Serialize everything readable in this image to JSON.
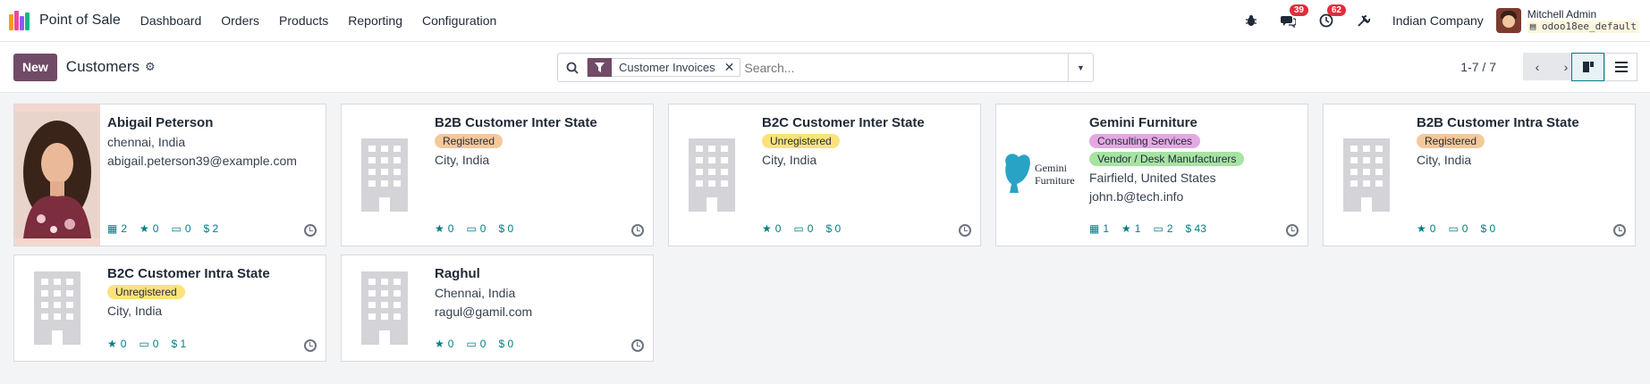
{
  "navbar": {
    "app_name": "Point of Sale",
    "menu": [
      "Dashboard",
      "Orders",
      "Products",
      "Reporting",
      "Configuration"
    ],
    "chat_count": "39",
    "activity_count": "62",
    "company": "Indian Company",
    "user_name": "Mitchell Admin",
    "user_db": "odoo18ee_default"
  },
  "control": {
    "new_label": "New",
    "title": "Customers",
    "facet_label": "Customer Invoices",
    "search_placeholder": "Search...",
    "pager": "1-7 / 7"
  },
  "cards": [
    {
      "name": "Abigail Peterson",
      "tags": [],
      "lines": [
        "chennai, India",
        "abigail.peterson39@example.com"
      ],
      "stats": {
        "meetings": "2",
        "opportunities": "0",
        "invoices": "0",
        "sales": "$ 2"
      },
      "image": "photo"
    },
    {
      "name": "B2B Customer Inter State",
      "tags": [
        {
          "label": "Registered",
          "color": "registered"
        }
      ],
      "lines": [
        "City, India"
      ],
      "stats": {
        "opportunities": "0",
        "invoices": "0",
        "sales": "$ 0"
      },
      "image": "building"
    },
    {
      "name": "B2C Customer Inter State",
      "tags": [
        {
          "label": "Unregistered",
          "color": "unregistered"
        }
      ],
      "lines": [
        "City, India"
      ],
      "stats": {
        "opportunities": "0",
        "invoices": "0",
        "sales": "$ 0"
      },
      "image": "building"
    },
    {
      "name": "Gemini Furniture",
      "tags": [
        {
          "label": "Consulting Services",
          "color": "consulting"
        },
        {
          "label": "Vendor / Desk Manufacturers",
          "color": "vendor"
        }
      ],
      "lines": [
        "Fairfield, United States",
        "john.b@tech.info"
      ],
      "stats": {
        "meetings": "1",
        "opportunities": "1",
        "invoices": "2",
        "sales": "$ 43"
      },
      "image": "gemini"
    },
    {
      "name": "B2B Customer Intra State",
      "tags": [
        {
          "label": "Registered",
          "color": "registered"
        }
      ],
      "lines": [
        "City, India"
      ],
      "stats": {
        "opportunities": "0",
        "invoices": "0",
        "sales": "$ 0"
      },
      "image": "building"
    },
    {
      "name": "B2C Customer Intra State",
      "tags": [
        {
          "label": "Unregistered",
          "color": "unregistered"
        }
      ],
      "lines": [
        "City, India"
      ],
      "stats": {
        "opportunities": "0",
        "invoices": "0",
        "sales": "$ 1"
      },
      "image": "building"
    },
    {
      "name": "Raghul",
      "tags": [],
      "lines": [
        "Chennai, India",
        "ragul@gamil.com"
      ],
      "stats": {
        "opportunities": "0",
        "invoices": "0",
        "sales": "$ 0"
      },
      "image": "building"
    }
  ],
  "gemini_logo_text": [
    "Gemini",
    "Furniture"
  ],
  "colors": {
    "brand": "#714b67",
    "accent": "#017e84",
    "badge": "#e02c3a"
  }
}
